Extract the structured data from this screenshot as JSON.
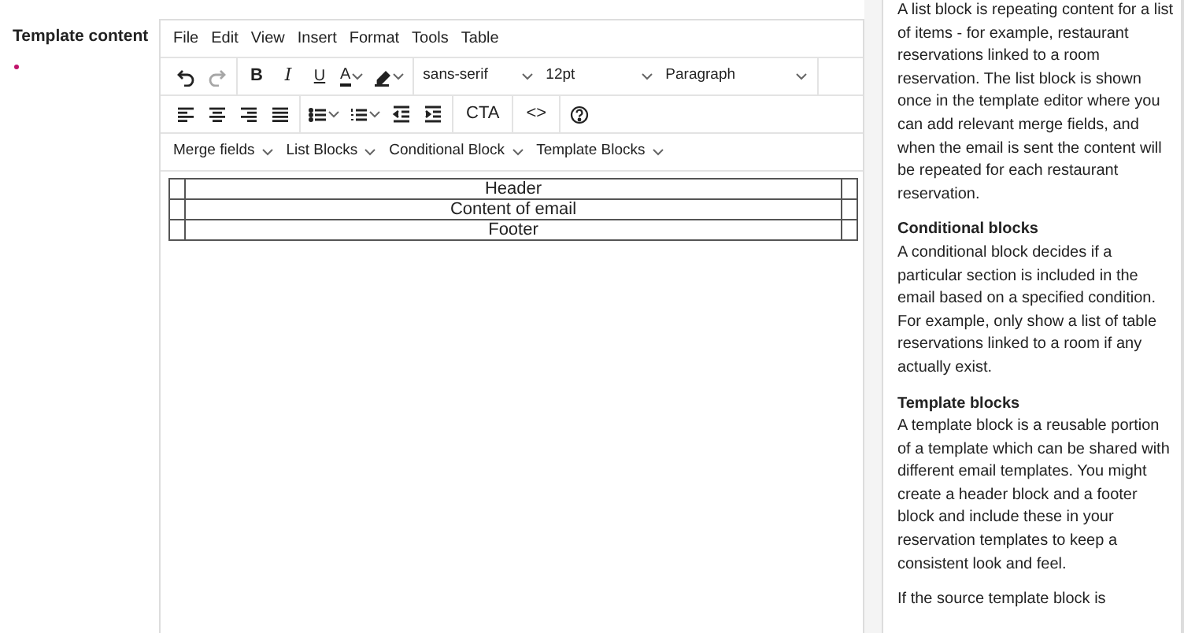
{
  "field": {
    "label": "Template content",
    "required": true
  },
  "editor": {
    "menubar": [
      "File",
      "Edit",
      "View",
      "Insert",
      "Format",
      "Tools",
      "Table"
    ],
    "history": {
      "undo_disabled": false,
      "redo_disabled": true
    },
    "format_buttons": [
      {
        "kind": "bold",
        "label": "B"
      },
      {
        "kind": "italic",
        "label": "I"
      },
      {
        "kind": "underline",
        "label": "U"
      },
      {
        "kind": "color",
        "label": "A",
        "color": "#1a1a1a"
      }
    ],
    "selects": [
      {
        "value": "sans-serif"
      },
      {
        "value": "12pt"
      },
      {
        "value": "Paragraph"
      }
    ],
    "text_buttons": [
      "CTA",
      "<>"
    ],
    "block_menus": [
      "Merge fields",
      "List Blocks",
      "Conditional Block",
      "Template Blocks"
    ],
    "content_table": [
      {
        "text": "Header"
      },
      {
        "text": "Content of email"
      },
      {
        "text": "Footer"
      }
    ]
  },
  "help_panel": [
    {
      "kind": "text",
      "text": "A list block is repeating content for a list of items - for example, restaurant reservations linked to a room reservation. The list block is shown once in the template editor where you can add relevant merge fields, and when the email is sent the content will be repeated for each restaurant reservation."
    },
    {
      "kind": "heading",
      "text": "Conditional blocks"
    },
    {
      "kind": "text",
      "text": "A conditional block decides if a particular section is included in the email based on a specified condition. For example, only show a list of table reservations linked to a room if any actually exist."
    },
    {
      "kind": "heading",
      "text": "Template blocks"
    },
    {
      "kind": "text",
      "text": "A template block is a reusable portion of a template which can be shared with different email templates. You might create a header block and a footer block and include these in your reservation templates to keep a consistent look and feel."
    },
    {
      "kind": "text",
      "text": "If the source template block is"
    }
  ]
}
